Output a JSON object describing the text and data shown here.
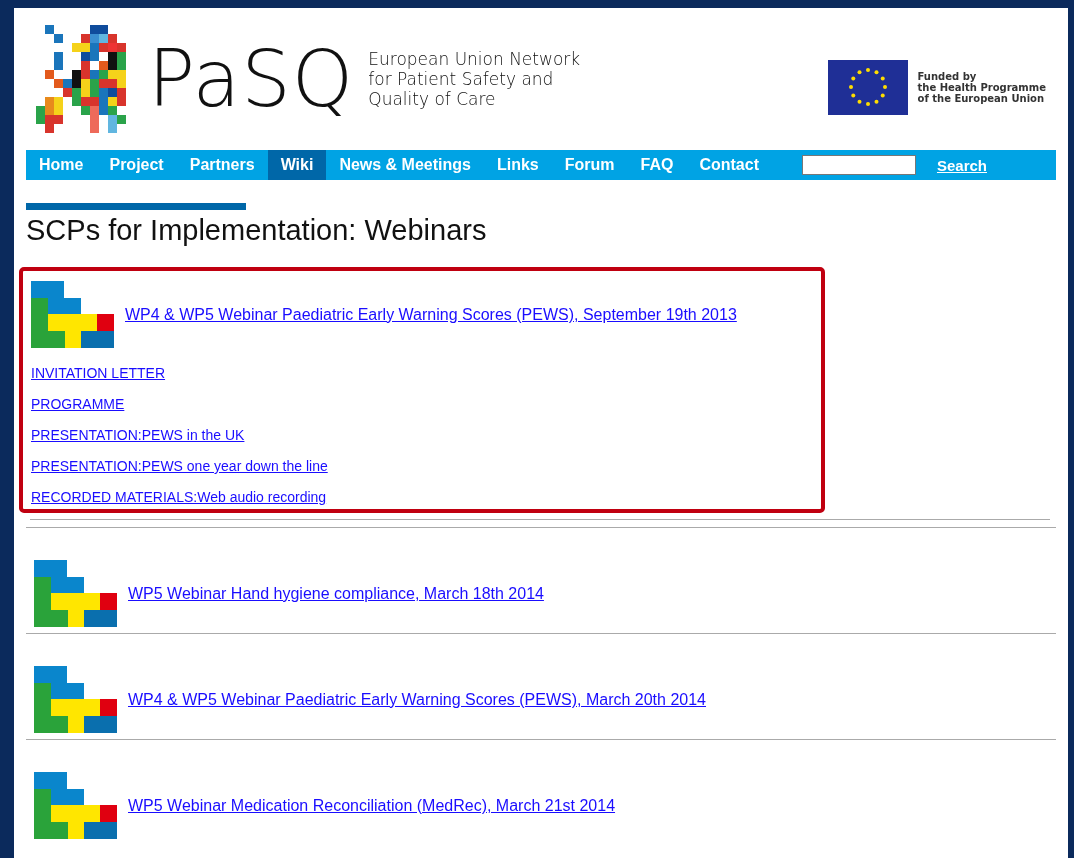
{
  "header": {
    "logo_text": "PaSQ",
    "tagline": [
      "European Union Network",
      "for Patient Safety and",
      "Quality of Care"
    ],
    "funding": [
      "Funded by",
      "the Health Programme",
      "of the European Union"
    ]
  },
  "nav": {
    "items": [
      {
        "label": "Home",
        "selected": false
      },
      {
        "label": "Project",
        "selected": false
      },
      {
        "label": "Partners",
        "selected": false
      },
      {
        "label": "Wiki",
        "selected": true
      },
      {
        "label": "News & Meetings",
        "selected": false
      },
      {
        "label": "Links",
        "selected": false
      },
      {
        "label": "Forum",
        "selected": false
      },
      {
        "label": "FAQ",
        "selected": false
      },
      {
        "label": "Contact",
        "selected": false
      }
    ],
    "search_button": "Search"
  },
  "page_title": "SCPs for Implementation: Webinars",
  "webinars": [
    {
      "title": "WP4 & WP5 Webinar Paediatric Early Warning Scores (PEWS), September 19th 2013",
      "highlighted": true,
      "materials": [
        "INVITATION LETTER",
        "PROGRAMME",
        "PRESENTATION:PEWS in the UK",
        "PRESENTATION:PEWS one year down the line",
        "RECORDED MATERIALS:Web audio recording"
      ]
    },
    {
      "title": "WP5 Webinar Hand hygiene compliance, March 18th 2014",
      "highlighted": false
    },
    {
      "title": "WP4 & WP5 Webinar Paediatric Early Warning Scores (PEWS), March 20th 2014",
      "highlighted": false
    },
    {
      "title": "WP5 Webinar Medication Reconciliation (MedRec), March 21st 2014",
      "highlighted": false
    }
  ]
}
